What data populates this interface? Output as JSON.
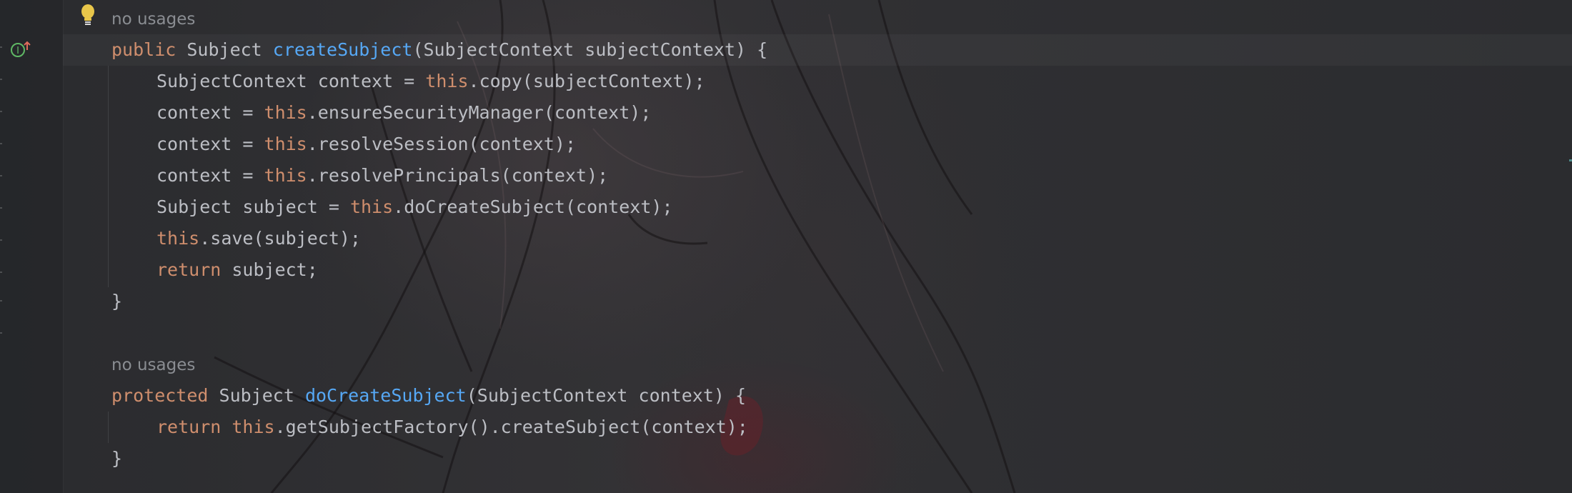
{
  "editor": {
    "hint_usages_1": "no usages",
    "hint_usages_2": "no usages",
    "colors": {
      "keyword": "#cf8e6d",
      "method_declaration": "#56a8f5",
      "default_text": "#bcbec4",
      "inlay_hint": "#8a8d92"
    },
    "gutter_icons": [
      "lightbulb-icon",
      "implementation-icon"
    ],
    "lines": {
      "l1": {
        "kw1": "public",
        "t1": " Subject ",
        "fn": "createSubject",
        "t2": "(SubjectContext subjectContext) {"
      },
      "l2": {
        "t1": "SubjectContext context = ",
        "kw": "this",
        "t2": ".copy(subjectContext);"
      },
      "l3": {
        "t1": "context = ",
        "kw": "this",
        "t2": ".ensureSecurityManager(context);"
      },
      "l4": {
        "t1": "context = ",
        "kw": "this",
        "t2": ".resolveSession(context);"
      },
      "l5": {
        "t1": "context = ",
        "kw": "this",
        "t2": ".resolvePrincipals(context);"
      },
      "l6": {
        "t1": "Subject subject = ",
        "kw": "this",
        "t2": ".doCreateSubject(context);"
      },
      "l7": {
        "kw": "this",
        "t2": ".save(subject);"
      },
      "l8": {
        "kw": "return",
        "t2": " subject;"
      },
      "l9": {
        "t": "}"
      },
      "l10": {
        "kw1": "protected",
        "t1": " Subject ",
        "fn": "doCreateSubject",
        "t2": "(SubjectContext context) {"
      },
      "l11": {
        "kw1": "return",
        "t1": " ",
        "kw2": "this",
        "t2": ".getSubjectFactory().createSubject(context);"
      },
      "l12": {
        "t": "}"
      }
    }
  }
}
